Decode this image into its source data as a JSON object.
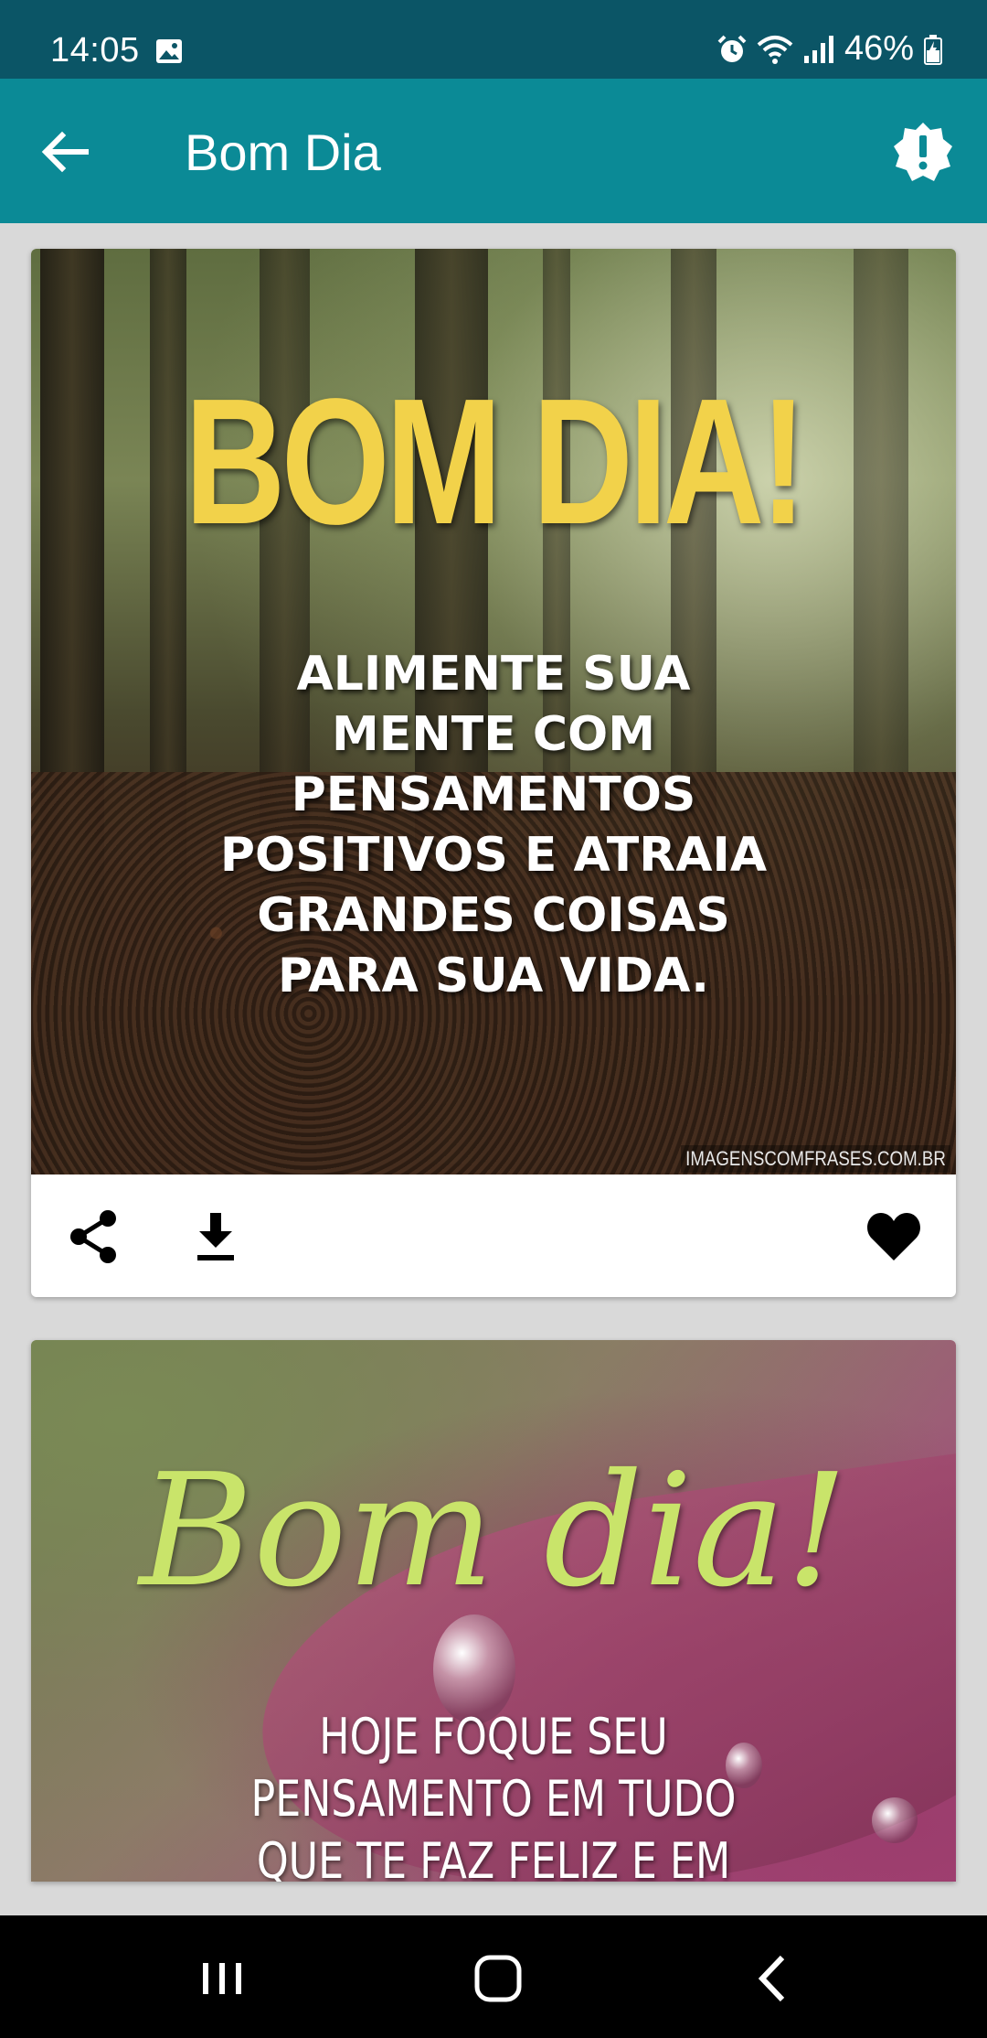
{
  "status_bar": {
    "time": "14:05",
    "battery": "46%",
    "icons": [
      "image-icon",
      "alarm-icon",
      "wifi-icon",
      "signal-icon",
      "battery-icon"
    ]
  },
  "app_bar": {
    "title": "Bom Dia",
    "back_icon": "arrow-back-icon",
    "report_icon": "report-icon",
    "color": "#0b8a96"
  },
  "cards": [
    {
      "headline": "BOM DIA!",
      "quote": "ALIMENTE SUA\nMENTE COM\nPENSAMENTOS\nPOSITIVOS E ATRAIA\nGRANDES COISAS\nPARA SUA VIDA.",
      "watermark": "IMAGENSCOMFRASES.COM.BR",
      "actions": [
        "share-icon",
        "download-icon",
        "heart-icon"
      ]
    },
    {
      "headline": "Bom dia!",
      "quote": "HOJE FOQUE SEU\nPENSAMENTO EM TUDO\nQUE TE FAZ FELIZ E EM"
    }
  ],
  "nav_bar": {
    "icons": [
      "recents-icon",
      "home-icon",
      "back-icon"
    ]
  },
  "colors": {
    "status_bar": "#0b5566",
    "app_bar": "#0b8a96",
    "background": "#d9d9d9",
    "headline_yellow": "#f2d24a",
    "script_green": "#c9e46a"
  }
}
